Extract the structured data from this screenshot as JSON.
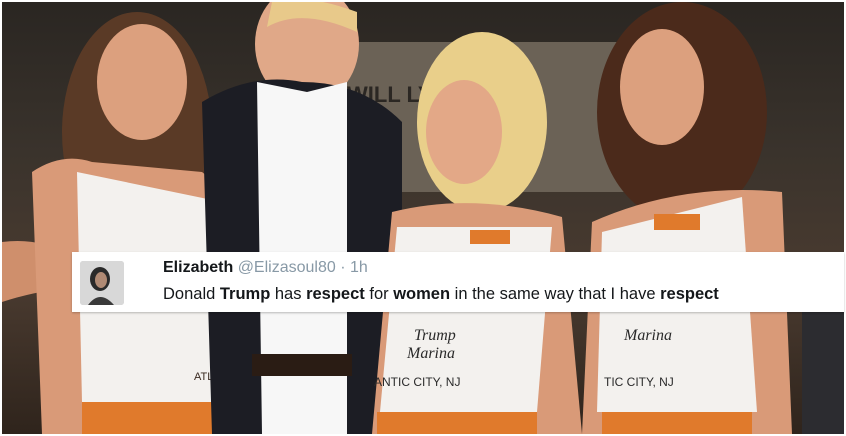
{
  "tweet": {
    "name": "Elizabeth",
    "handle": "@Elizasoul80",
    "separator": "·",
    "time": "1h",
    "text_parts": [
      {
        "text": "Donald ",
        "bold": false
      },
      {
        "text": "Trump",
        "bold": true
      },
      {
        "text": " has ",
        "bold": false
      },
      {
        "text": "respect",
        "bold": true
      },
      {
        "text": " for ",
        "bold": false
      },
      {
        "text": "women",
        "bold": true
      },
      {
        "text": " in the same way that I have ",
        "bold": false
      },
      {
        "text": "respect",
        "bold": true
      }
    ]
  },
  "photo": {
    "background_sign": "WILL ... LY AW",
    "shirt_text_1": "Trump Marina",
    "shirt_text_2": "ATLANTIC CITY, NJ",
    "shirt_text_3": "Trump Marina",
    "shirt_text_4": "NTIC CITY, NJ",
    "shirt_text_5": "ATLA",
    "colors": {
      "skin": "#d99a78",
      "tank": "#f3f1ee",
      "shorts": "#e07a2c",
      "suit": "#1c1d24",
      "hair_blonde": "#e9cf8a",
      "hair_brown": "#5a3a26"
    }
  }
}
